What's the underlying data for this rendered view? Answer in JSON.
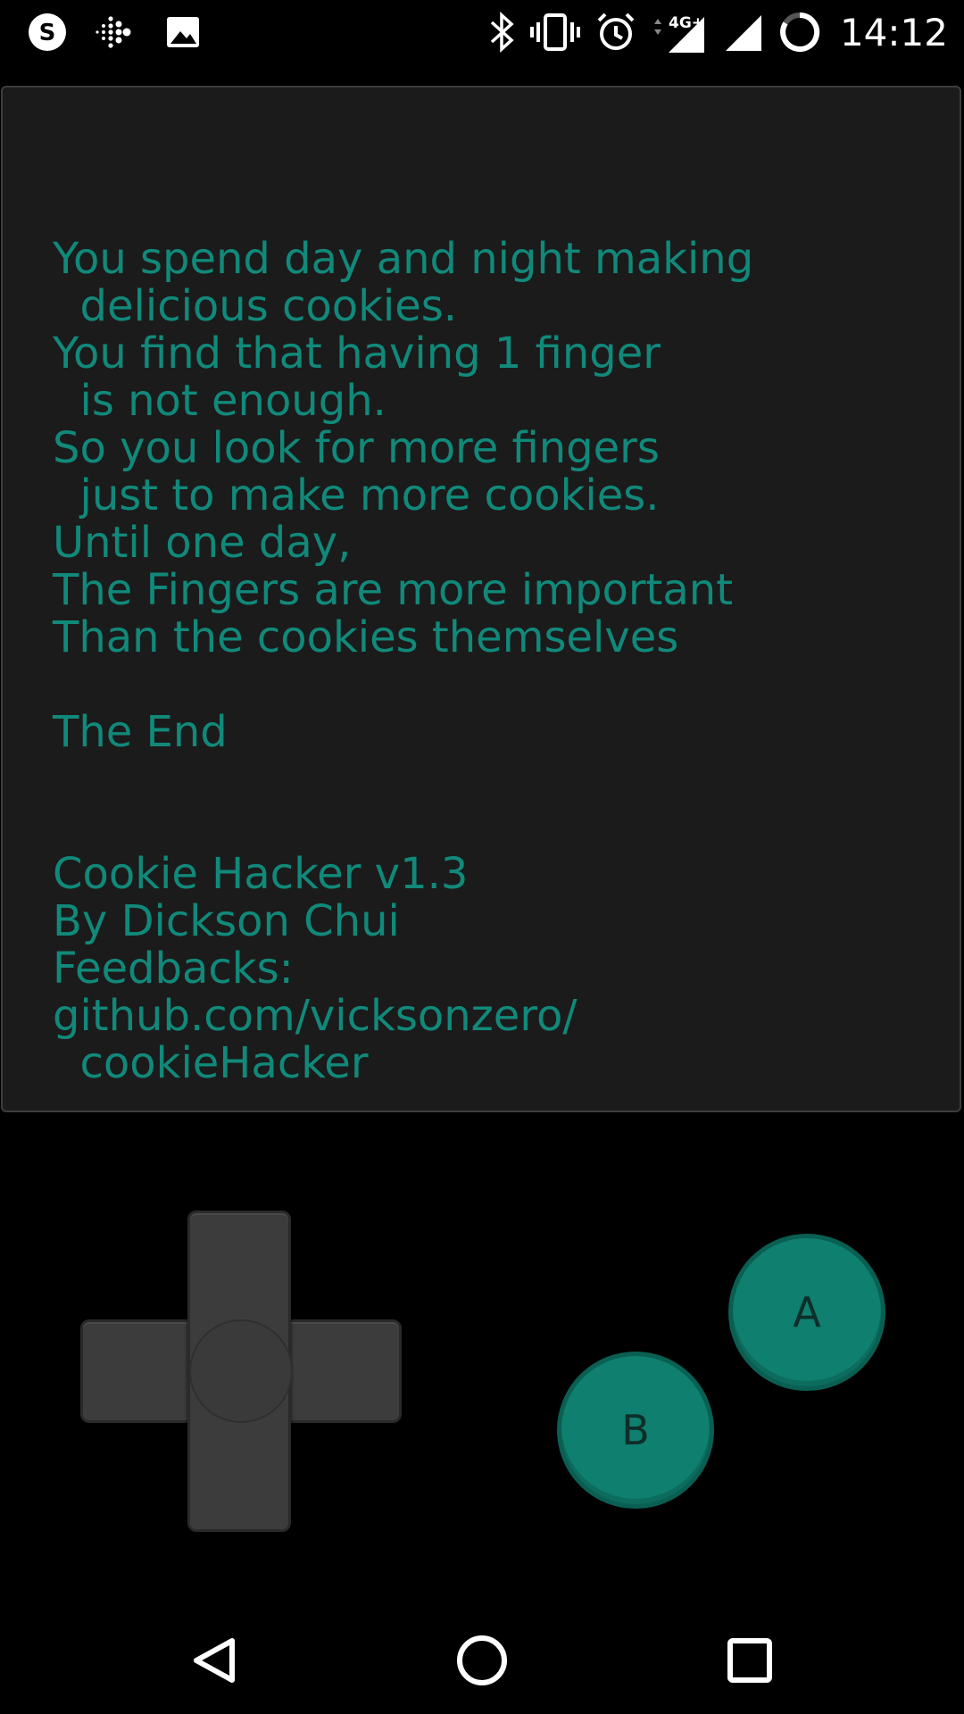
{
  "status_bar": {
    "time": "14:12",
    "network_label": "4G",
    "left_icons": [
      "skype-icon",
      "fitbit-icon",
      "image-icon"
    ],
    "right_icons": [
      "bluetooth-icon",
      "vibrate-icon",
      "alarm-icon",
      "data-arrows-icon",
      "signal-icon",
      "signal-icon",
      "battery-ring-icon"
    ]
  },
  "screen": {
    "lines": [
      "You spend day and night making",
      "  delicious cookies.",
      "You find that having 1 finger",
      "  is not enough.",
      "So you look for more fingers",
      "  just to make more cookies.",
      "Until one day,",
      "The Fingers are more important",
      "Than the cookies themselves",
      "",
      "The End",
      "",
      "",
      "Cookie Hacker v1.3",
      "By Dickson Chui",
      "Feedbacks:",
      "github.com/vicksonzero/",
      "  cookieHacker"
    ]
  },
  "controls": {
    "a_label": "A",
    "b_label": "B"
  },
  "colors": {
    "accent": "#11897a",
    "screen_bg": "#1b1b1b",
    "button": "#0f7f6f",
    "dpad": "#3c3c3c"
  },
  "nav_bar": {
    "icons": [
      "back-icon",
      "home-icon",
      "recents-icon"
    ]
  }
}
